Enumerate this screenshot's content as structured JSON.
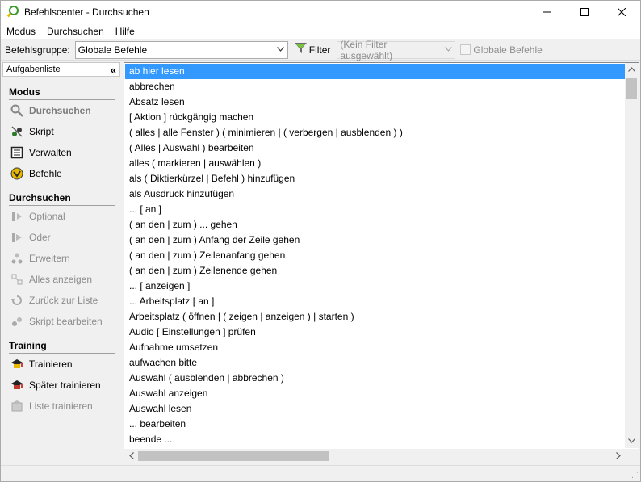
{
  "window": {
    "title": "Befehlscenter - Durchsuchen",
    "minimize": "—",
    "maximize": "☐",
    "close": "✕"
  },
  "menu": [
    "Modus",
    "Durchsuchen",
    "Hilfe"
  ],
  "toolbar": {
    "group_label": "Befehlsgruppe:",
    "group_value": "Globale Befehle",
    "filter_label": "Filter",
    "filter_value": "(Kein Filter ausgewählt)",
    "global_label": "Globale Befehle"
  },
  "sidebar": {
    "header": "Aufgabenliste",
    "collapse": "«",
    "sections": [
      {
        "title": "Modus",
        "items": [
          {
            "label": "Durchsuchen",
            "icon": "magnifier-icon",
            "state": "active"
          },
          {
            "label": "Skript",
            "icon": "script-icon",
            "state": "normal"
          },
          {
            "label": "Verwalten",
            "icon": "manage-icon",
            "state": "normal"
          },
          {
            "label": "Befehle",
            "icon": "commands-icon",
            "state": "normal"
          }
        ]
      },
      {
        "title": "Durchsuchen",
        "items": [
          {
            "label": "Optional",
            "icon": "optional-icon",
            "state": "disabled"
          },
          {
            "label": "Oder",
            "icon": "or-icon",
            "state": "disabled"
          },
          {
            "label": "Erweitern",
            "icon": "expand-icon",
            "state": "disabled"
          },
          {
            "label": "Alles anzeigen",
            "icon": "show-all-icon",
            "state": "disabled"
          },
          {
            "label": "Zurück zur Liste",
            "icon": "back-to-list-icon",
            "state": "disabled"
          },
          {
            "label": "Skript bearbeiten",
            "icon": "edit-script-icon",
            "state": "disabled"
          }
        ]
      },
      {
        "title": "Training",
        "items": [
          {
            "label": "Trainieren",
            "icon": "train-icon",
            "state": "normal"
          },
          {
            "label": "Später trainieren",
            "icon": "train-later-icon",
            "state": "normal"
          },
          {
            "label": "Liste trainieren",
            "icon": "train-list-icon",
            "state": "disabled"
          }
        ]
      }
    ]
  },
  "commands": [
    "ab hier lesen",
    "abbrechen",
    "Absatz lesen",
    "[ Aktion ] rückgängig machen",
    "( alles | alle Fenster ) ( minimieren | ( verbergen | ausblenden ) )",
    "( Alles | Auswahl ) bearbeiten",
    "alles ( markieren | auswählen )",
    "als ( Diktierkürzel | Befehl ) hinzufügen",
    "als Ausdruck hinzufügen",
    "... [ an ]",
    "( an den | zum ) ... gehen",
    "( an den | zum ) Anfang der Zeile gehen",
    "( an den | zum ) Zeilenanfang gehen",
    "( an den | zum ) Zeilenende gehen",
    "... [ anzeigen ]",
    "... Arbeitsplatz [ an ]",
    "Arbeitsplatz ( öffnen | ( zeigen | anzeigen ) | starten )",
    "Audio [ Einstellungen ] prüfen",
    "Aufnahme umsetzen",
    "aufwachen bitte",
    "Auswahl ( ausblenden | abbrechen )",
    "Auswahl anzeigen",
    "Auswahl lesen",
    "... bearbeiten",
    "beende ..."
  ],
  "selected_index": 0,
  "colors": {
    "selection": "#3399ff",
    "disabled_text": "#8d8d8d"
  }
}
